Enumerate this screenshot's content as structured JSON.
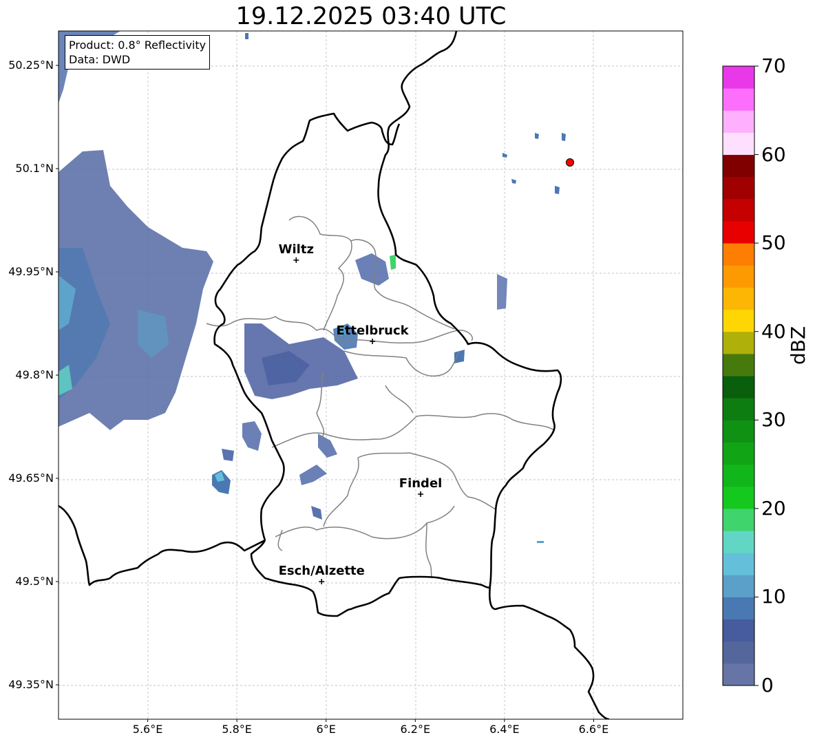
{
  "title": "19.12.2025 03:40 UTC",
  "info": {
    "product": "Product: 0.8° Reflectivity",
    "data": "Data: DWD"
  },
  "lat_ticks": [
    "50.25°N",
    "50.1°N",
    "49.95°N",
    "49.8°N",
    "49.65°N",
    "49.5°N",
    "49.35°N"
  ],
  "lon_ticks": [
    "5.6°E",
    "5.8°E",
    "6°E",
    "6.2°E",
    "6.4°E",
    "6.6°E"
  ],
  "colorbar": {
    "label": "dBZ",
    "ticks": [
      "0",
      "10",
      "20",
      "30",
      "40",
      "50",
      "60",
      "70"
    ],
    "range": [
      0,
      70
    ],
    "step": 2.5,
    "colors": [
      "#6674a6",
      "#54679d",
      "#465c9e",
      "#4a78b2",
      "#5aa0c8",
      "#64c0da",
      "#62d6c4",
      "#3fd46c",
      "#14c81e",
      "#11b61a",
      "#11a516",
      "#0f9114",
      "#0d7d12",
      "#095f0c",
      "#477a0c",
      "#afb00a",
      "#fed603",
      "#fdb604",
      "#fd9a01",
      "#fd7e03",
      "#e80001",
      "#c50000",
      "#a10000",
      "#800000",
      "#fedffe",
      "#feb0fe",
      "#fd6efd",
      "#e838e8"
    ]
  },
  "cities": [
    {
      "name": "Wiltz",
      "lon": 5.933,
      "lat": 49.967
    },
    {
      "name": "Ettelbruck",
      "lon": 6.104,
      "lat": 49.849
    },
    {
      "name": "Findel",
      "lon": 6.212,
      "lat": 49.627
    },
    {
      "name": "Esch/Alzette",
      "lon": 5.99,
      "lat": 49.5
    }
  ],
  "radar_site": {
    "lon": 6.548,
    "lat": 50.11,
    "color": "#ff0000"
  },
  "extent": {
    "lon": [
      5.4,
      6.8
    ],
    "lat": [
      49.3,
      50.3
    ]
  }
}
